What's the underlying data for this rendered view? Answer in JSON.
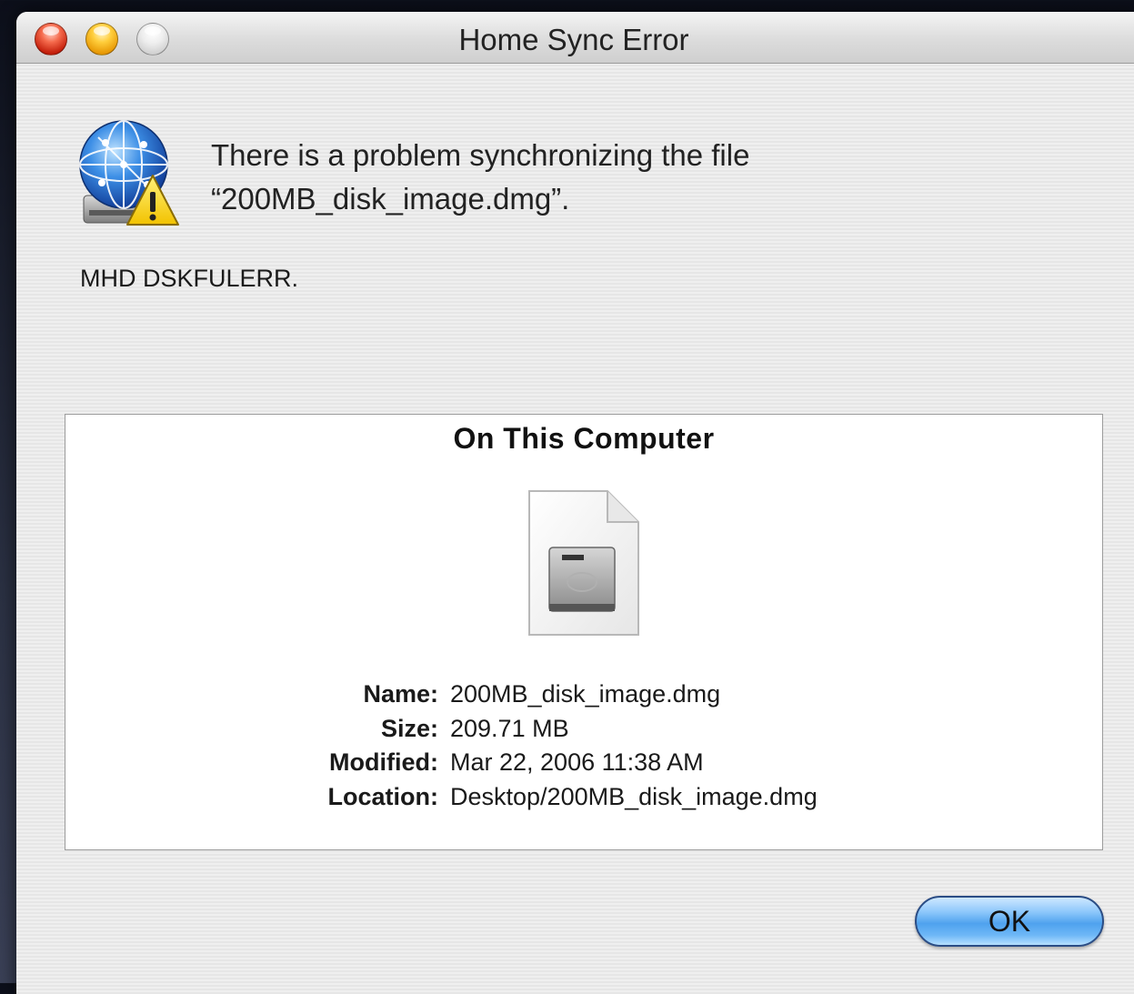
{
  "window": {
    "title": "Home Sync Error"
  },
  "alert": {
    "message_line1": "There is a problem synchronizing the file",
    "message_line2": "“200MB_disk_image.dmg”.",
    "error_code": "MHD DSKFULERR.",
    "icon": "network-disk-warning-icon"
  },
  "file_panel": {
    "title": "On This Computer",
    "file_icon": "disk-image-document-icon",
    "rows": [
      {
        "label": "Name:",
        "value": "200MB_disk_image.dmg"
      },
      {
        "label": "Size:",
        "value": "209.71 MB"
      },
      {
        "label": "Modified:",
        "value": "Mar 22, 2006 11:38 AM"
      },
      {
        "label": "Location:",
        "value": "Desktop/200MB_disk_image.dmg"
      }
    ]
  },
  "buttons": {
    "ok_label": "OK"
  },
  "colors": {
    "close": "#e0442a",
    "minimize": "#f5b51c",
    "zoom": "#d8d8d8",
    "default_button": "#5aa8f0"
  }
}
